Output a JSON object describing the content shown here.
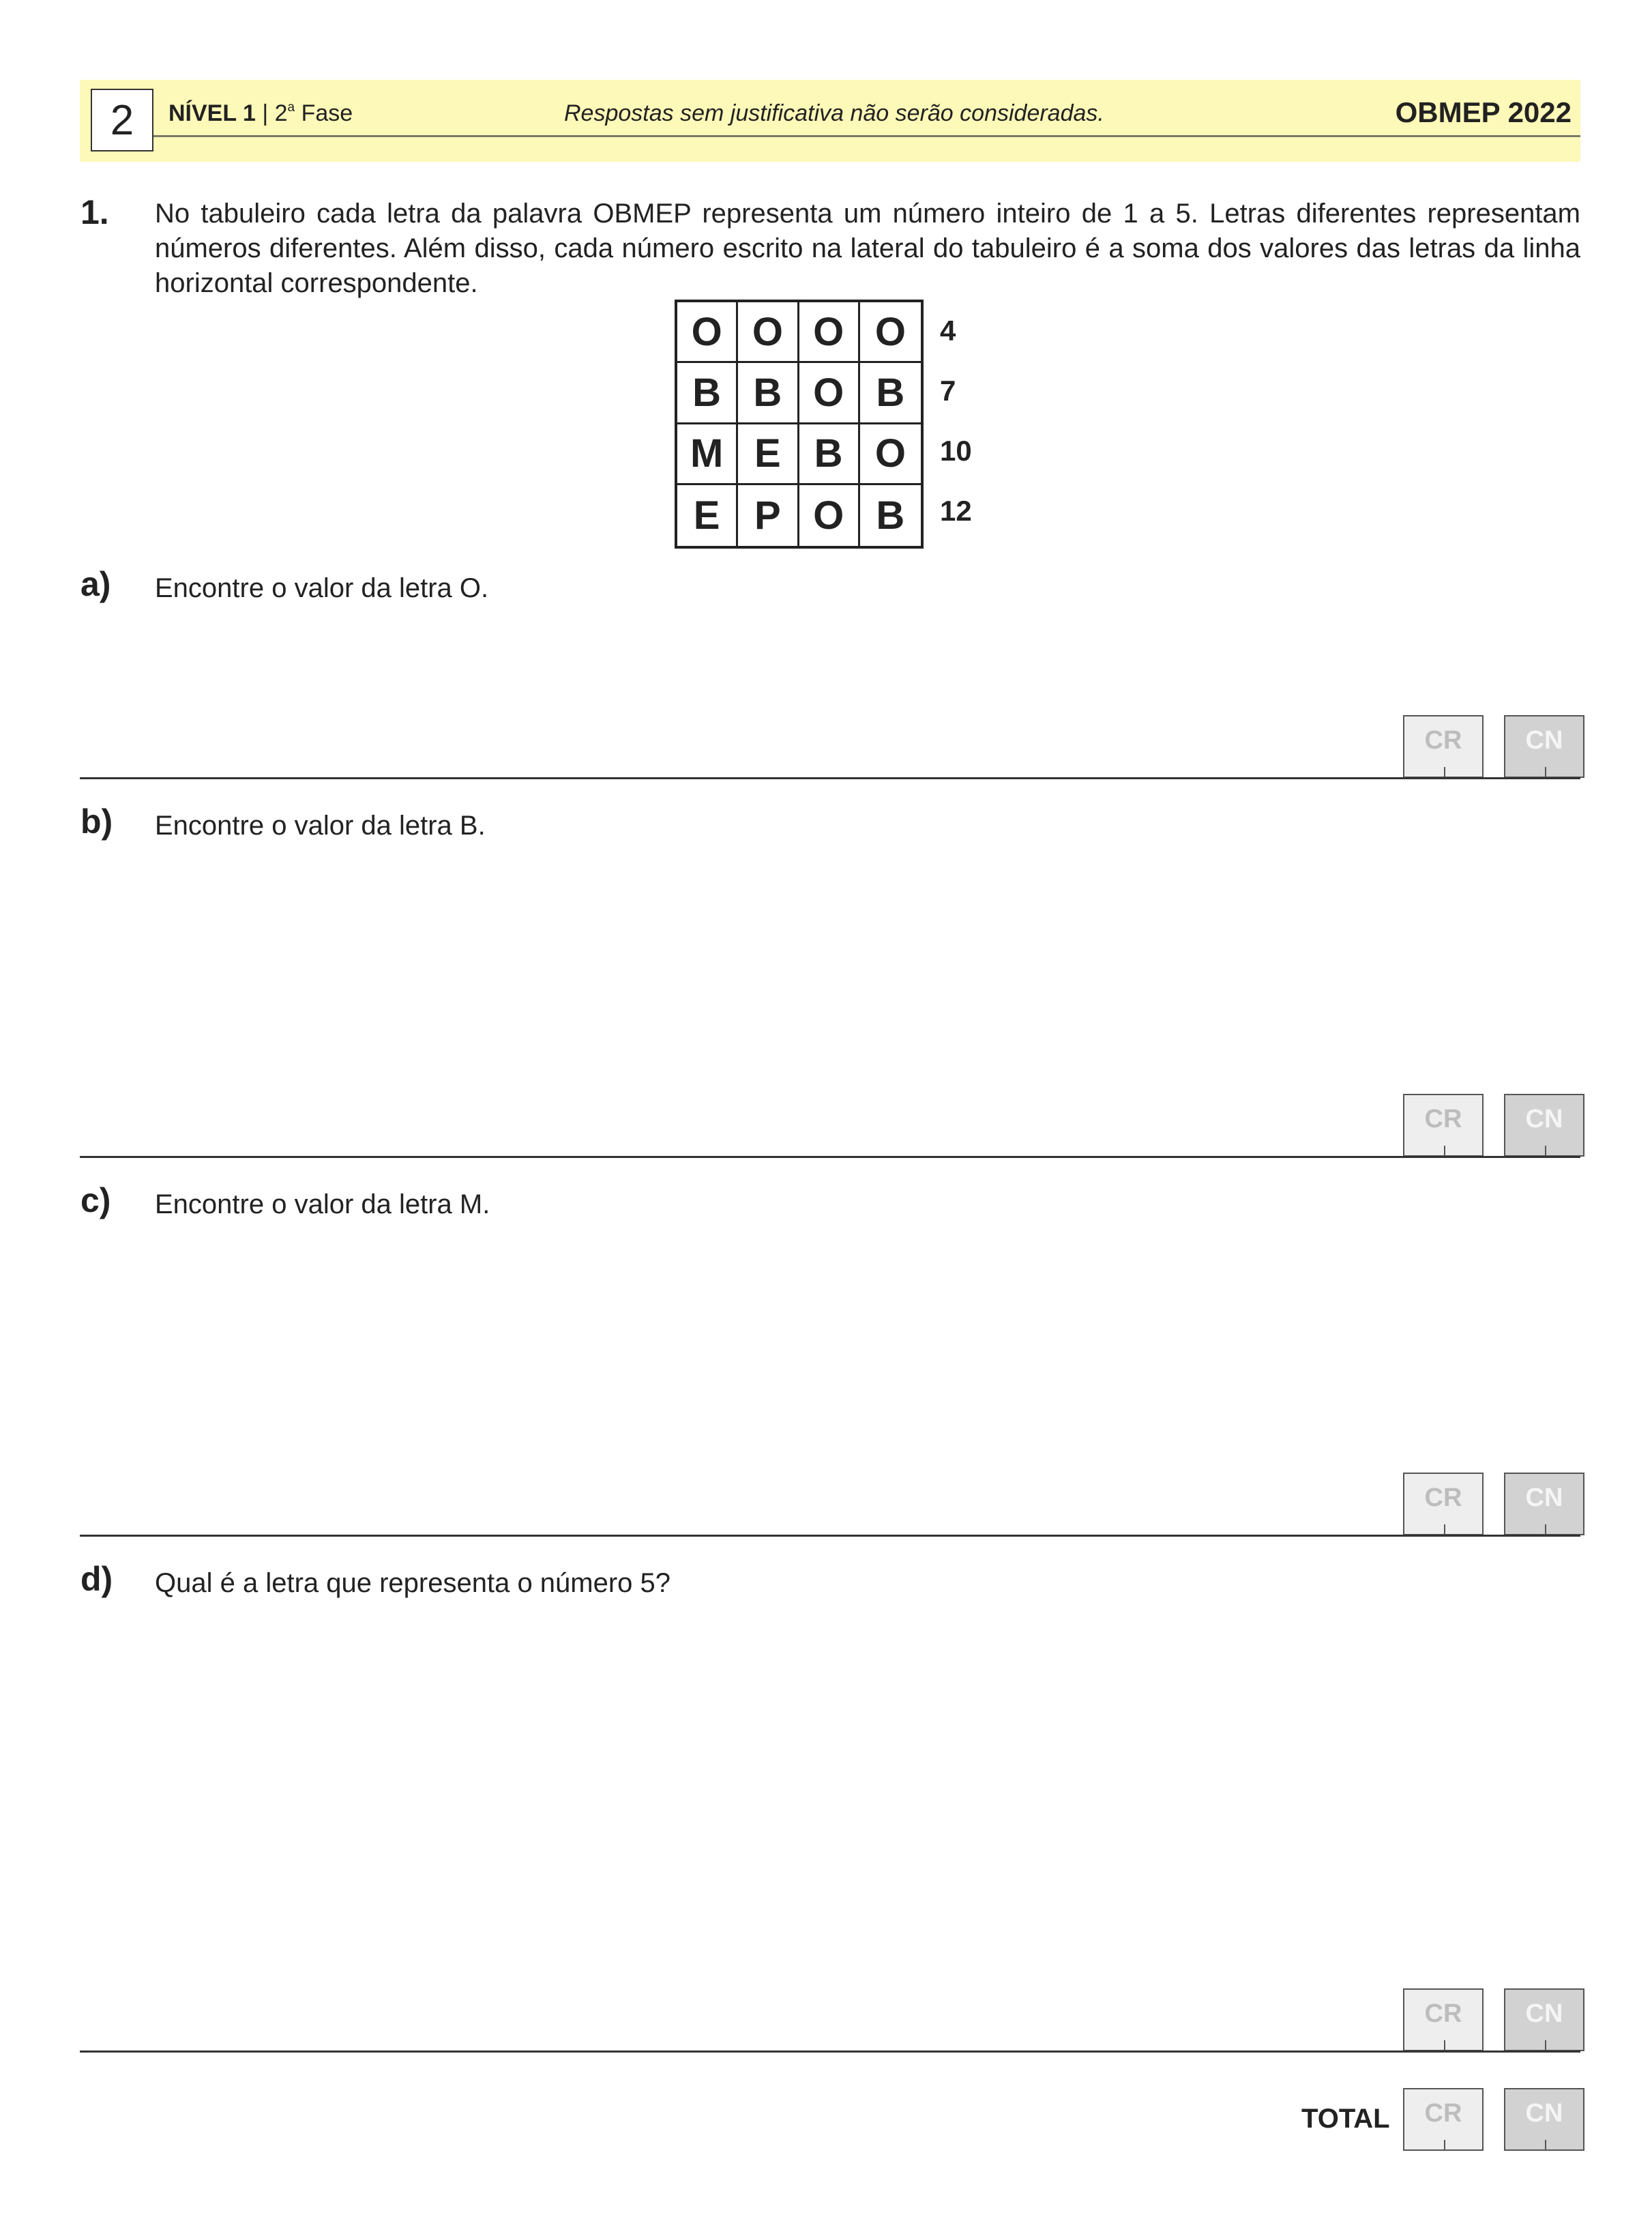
{
  "header": {
    "page_number": "2",
    "level_label": "NÍVEL 1",
    "separator": "|",
    "phase_number": "2",
    "phase_ordinal": "a",
    "phase_label": "Fase",
    "notice": "Respostas sem justificativa não serão consideradas.",
    "brand": "OBMEP 2022",
    "band_color": "#fdf9b8"
  },
  "problem": {
    "number": "1.",
    "statement": "No tabuleiro cada letra da palavra OBMEP representa um número inteiro de 1 a 5. Letras diferentes representam números diferentes. Além disso, cada número escrito na lateral do tabuleiro é a soma dos valores das letras da linha horizontal correspondente."
  },
  "board": {
    "rows": [
      [
        "O",
        "O",
        "O",
        "O"
      ],
      [
        "B",
        "B",
        "O",
        "B"
      ],
      [
        "M",
        "E",
        "B",
        "O"
      ],
      [
        "E",
        "P",
        "O",
        "B"
      ]
    ],
    "row_sums": [
      "4",
      "7",
      "10",
      "12"
    ]
  },
  "items": [
    {
      "label": "a)",
      "text": "Encontre o valor da letra O."
    },
    {
      "label": "b)",
      "text": "Encontre o valor da letra B."
    },
    {
      "label": "c)",
      "text": "Encontre o valor da letra M."
    },
    {
      "label": "d)",
      "text": "Qual é a letra que representa o número 5?"
    }
  ],
  "score_labels": {
    "cr": "CR",
    "cn": "CN"
  },
  "total_label": "TOTAL"
}
